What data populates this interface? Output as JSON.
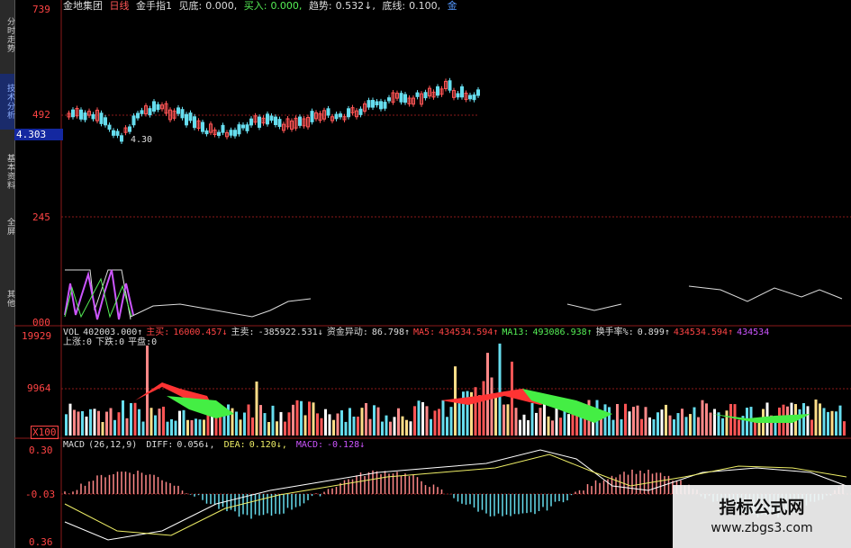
{
  "sidebar": {
    "tabs": [
      {
        "label": "分时走势",
        "active": false
      },
      {
        "label": "技术分析",
        "active": true
      },
      {
        "label": "基本资料",
        "active": false
      },
      {
        "label": "全屏",
        "active": false
      },
      {
        "label": "其他",
        "active": false
      }
    ]
  },
  "price_panel": {
    "stock_name": "金地集团",
    "period": "日线",
    "indicator": "金手指1",
    "info": [
      {
        "label": "见底:",
        "value": "0.000,"
      },
      {
        "label": "买入:",
        "value": "0.000,"
      },
      {
        "label": "趋势:",
        "value": "0.532↓,"
      },
      {
        "label": "底线:",
        "value": "0.100,"
      },
      {
        "label": "金",
        "value": ""
      }
    ],
    "y_labels": [
      "739",
      "492",
      "245",
      "000"
    ],
    "current_price": "4.303",
    "low_marker": "4.30",
    "colors": {
      "up": "#ff5555",
      "down": "#66ddee",
      "grid": "#8b1a1a",
      "axis": "#ff4444"
    }
  },
  "volume_panel": {
    "info_items": [
      {
        "text": "VOL",
        "color": "#dddddd"
      },
      {
        "text": "402003.000↑",
        "color": "#dddddd"
      },
      {
        "text": "主买:",
        "color": "#ff4444"
      },
      {
        "text": "16000.457↓",
        "color": "#ff4444"
      },
      {
        "text": "主卖:",
        "color": "#dddddd"
      },
      {
        "text": "-385922.531↓",
        "color": "#dddddd"
      },
      {
        "text": "资金异动:",
        "color": "#dddddd"
      },
      {
        "text": "86.798↑",
        "color": "#dddddd"
      },
      {
        "text": "MA5:",
        "color": "#ff4444"
      },
      {
        "text": "434534.594↑",
        "color": "#ff4444"
      },
      {
        "text": "MA13:",
        "color": "#55ee55"
      },
      {
        "text": "493086.938↑",
        "color": "#55ee55"
      },
      {
        "text": "换手率%:",
        "color": "#dddddd"
      },
      {
        "text": "0.899↑",
        "color": "#dddddd"
      },
      {
        "text": "434534.594↑",
        "color": "#ff4444"
      },
      {
        "text": "434534",
        "color": "#cc55ff"
      }
    ],
    "sub_items": [
      {
        "text": "上涨:0",
        "color": "#dddddd"
      },
      {
        "text": "下跌:0",
        "color": "#dddddd"
      },
      {
        "text": "平盘:0",
        "color": "#dddddd"
      }
    ],
    "y_labels": [
      "19929",
      "9964",
      "X100"
    ]
  },
  "macd_panel": {
    "title": "MACD",
    "params": "(26,12,9)",
    "diff_label": "DIFF:",
    "diff_value": "0.056↓,",
    "dea_label": "DEA:",
    "dea_value": "0.120↓,",
    "macd_label": "MACD:",
    "macd_value": "-0.128↓",
    "y_labels": [
      "0.30",
      "-0.03",
      "0.36"
    ]
  },
  "watermark": {
    "title": "指标公式网",
    "url": "www.zbgs3.com"
  }
}
